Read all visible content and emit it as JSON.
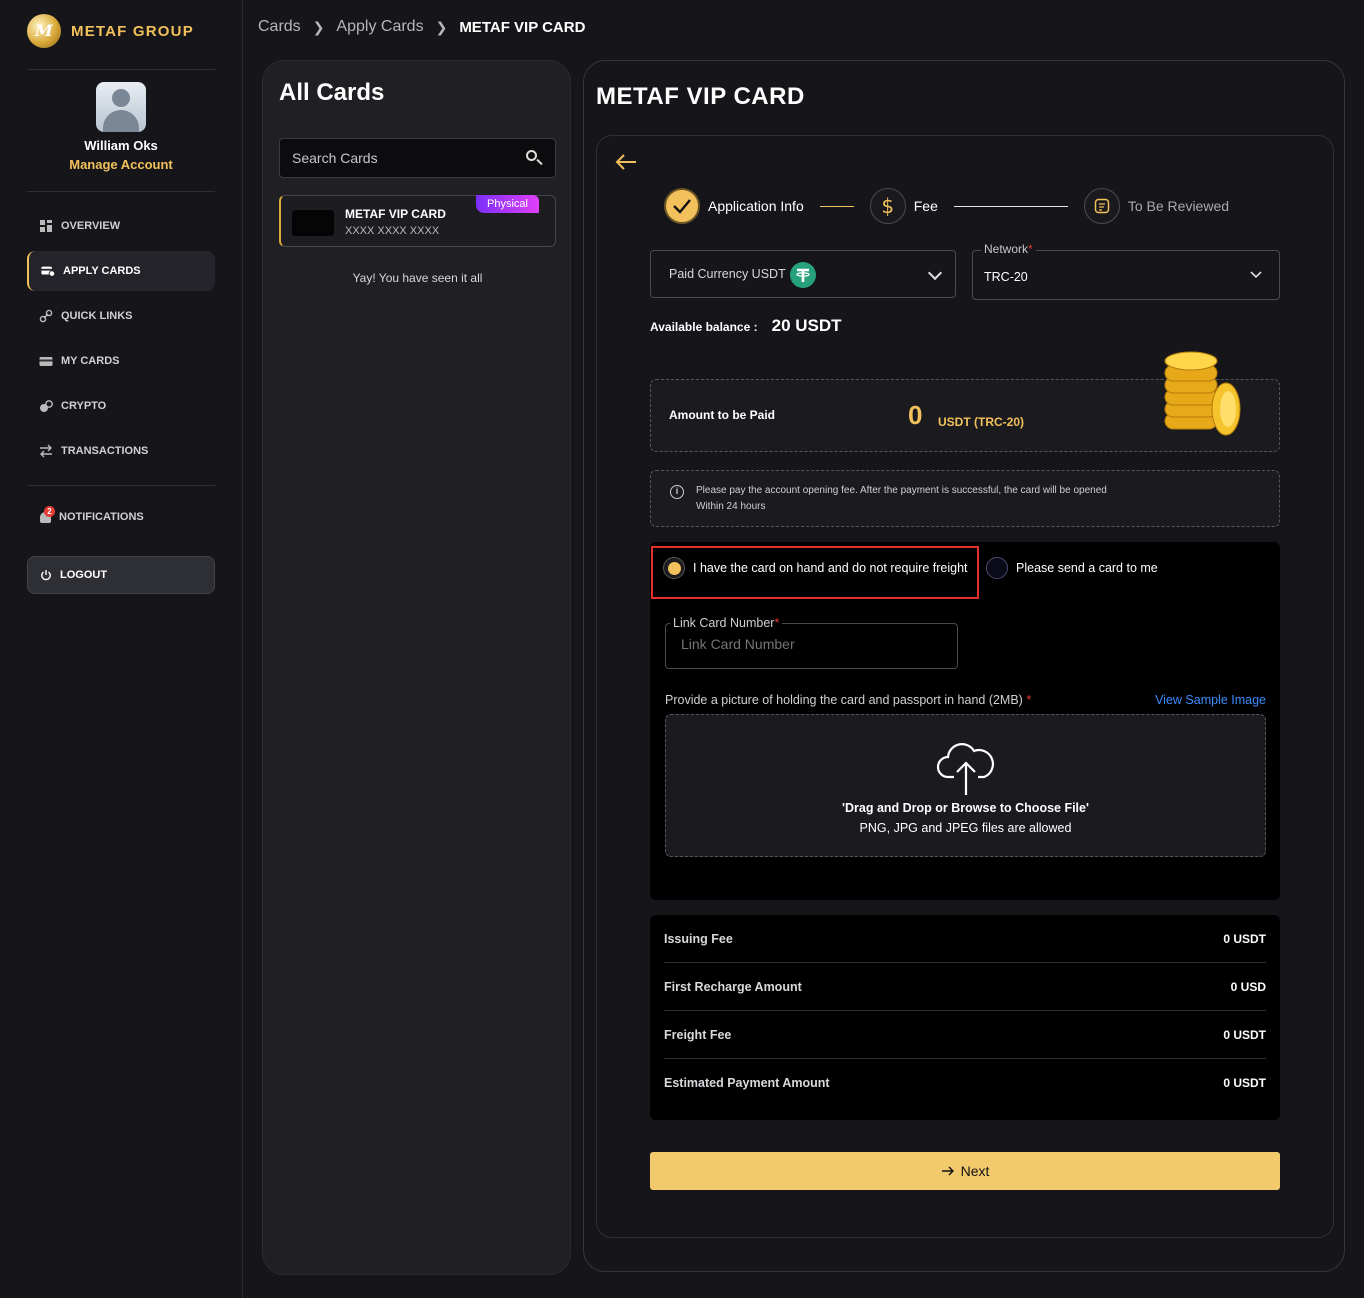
{
  "brand": {
    "name": "METAF GROUP"
  },
  "profile": {
    "name": "William Oks",
    "manage": "Manage Account"
  },
  "nav": [
    {
      "label": "OVERVIEW",
      "icon": "grid-icon"
    },
    {
      "label": "APPLY CARDS",
      "icon": "card-add-icon",
      "active": true
    },
    {
      "label": "QUICK LINKS",
      "icon": "link-icon"
    },
    {
      "label": "MY CARDS",
      "icon": "cards-icon"
    },
    {
      "label": "CRYPTO",
      "icon": "crypto-icon"
    },
    {
      "label": "TRANSACTIONS",
      "icon": "swap-icon"
    }
  ],
  "notifications": {
    "label": "NOTIFICATIONS",
    "count": "2"
  },
  "logout": {
    "label": "LOGOUT"
  },
  "breadcrumb": {
    "cards": "Cards",
    "apply": "Apply Cards",
    "current": "METAF VIP CARD"
  },
  "all_cards": {
    "title": "All Cards",
    "search_placeholder": "Search Cards",
    "card": {
      "name": "METAF VIP CARD",
      "number": "XXXX XXXX XXXX",
      "badge": "Physical"
    },
    "end_text": "Yay! You have seen it all"
  },
  "main": {
    "title": "METAF VIP CARD",
    "steps": [
      "Application Info",
      "Fee",
      "To Be Reviewed"
    ],
    "paid_currency": "Paid Currency USDT",
    "network_label": "Network",
    "network_value": "TRC-20",
    "balance_label": "Available balance :",
    "balance_value": "20 USDT",
    "amount_label": "Amount to be Paid",
    "amount_value": "0",
    "amount_unit": "USDT (TRC-20)",
    "info_text": "Please pay the account opening fee. After the payment is successful, the card will be opened Within 24 hours",
    "radio_on_hand": "I have the card on hand and do not require freight",
    "radio_send": "Please send a card to me",
    "link_card_label": "Link Card Number",
    "link_card_placeholder": "Link Card Number",
    "upload_label": "Provide a picture of holding the card and passport in hand (2MB)",
    "sample_link": "View Sample Image",
    "upload_title": "'Drag and Drop or Browse to Choose File'",
    "upload_sub": "PNG, JPG and JPEG files are allowed",
    "fees": [
      {
        "label": "Issuing Fee",
        "value": "0 USDT"
      },
      {
        "label": "First Recharge Amount",
        "value": "0 USD"
      },
      {
        "label": "Freight Fee",
        "value": "0 USDT"
      },
      {
        "label": "Estimated Payment Amount",
        "value": "0 USDT"
      }
    ],
    "next": "Next"
  },
  "colors": {
    "accent": "#f2c15b",
    "background": "#16161a",
    "link": "#3d8bfd",
    "highlight": "#e0312b"
  }
}
